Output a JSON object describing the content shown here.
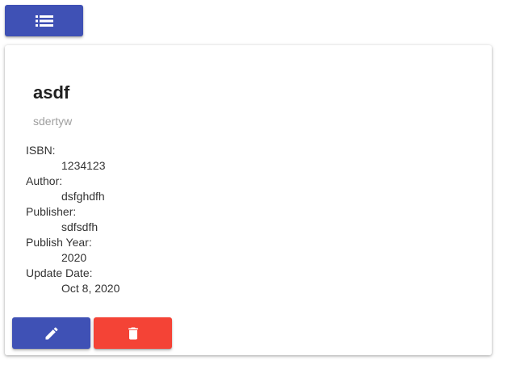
{
  "toolbar": {
    "list_button_icon": "list-icon"
  },
  "book": {
    "title": "asdf",
    "subtitle": "sdertyw",
    "fields": [
      {
        "label": "ISBN:",
        "value": "1234123"
      },
      {
        "label": "Author:",
        "value": "dsfghdfh"
      },
      {
        "label": "Publisher:",
        "value": "sdfsdfh"
      },
      {
        "label": "Publish Year:",
        "value": "2020"
      },
      {
        "label": "Update Date:",
        "value": "Oct 8, 2020"
      }
    ]
  },
  "actions": {
    "edit_icon": "pencil-icon",
    "delete_icon": "trash-icon"
  },
  "colors": {
    "primary": "#3f51b5",
    "danger": "#f44336",
    "subtitle": "#9e9e9e"
  }
}
